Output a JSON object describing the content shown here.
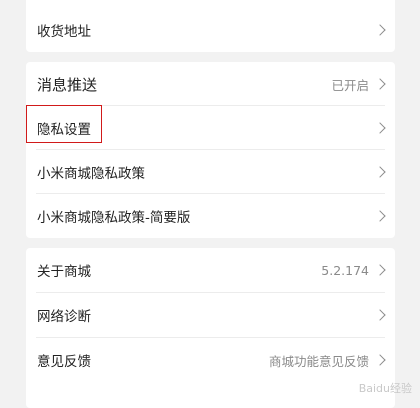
{
  "groups": {
    "address": {
      "label": "收货地址"
    },
    "settings": {
      "push": {
        "label": "消息推送",
        "value": "已开启"
      },
      "privacy": {
        "label": "隐私设置"
      },
      "policy": {
        "label": "小米商城隐私政策"
      },
      "policy_brief": {
        "label": "小米商城隐私政策-简要版"
      }
    },
    "about": {
      "about_store": {
        "label": "关于商城",
        "value": "5.2.174"
      },
      "diagnose": {
        "label": "网络诊断"
      },
      "feedback": {
        "label": "意见反馈",
        "value": "商城功能意见反馈"
      }
    }
  },
  "watermark": "Baidu经验",
  "colors": {
    "highlight": "#d11a1a",
    "background": "#f2f2f2",
    "card": "#ffffff"
  }
}
